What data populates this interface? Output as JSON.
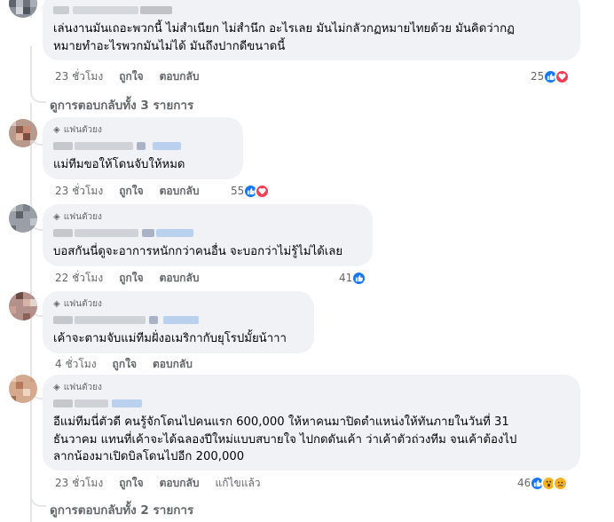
{
  "comments": [
    {
      "text": "เล่นงานมันเถอะพวกนี้ ไม่สำเนียก ไม่สำนึก อะไรเลย มันไม่กลัวกฏหมายไทยด้วย มันคิดว่ากฏ\nหมายทำอะไรพวกมันไม่ได้ มันถึงปากดีขนาดนี้",
      "time": "23 ชั่วโมง",
      "like": "ถูกใจ",
      "reply": "ตอบกลับ",
      "reactions_count": "25",
      "reactions": [
        "like-icon",
        "love-icon"
      ]
    },
    {
      "badge": "แฟนตัวยง",
      "text": "แม่ทีมขอให้โดนจับให้หมด",
      "time": "23 ชั่วโมง",
      "like": "ถูกใจ",
      "reply": "ตอบกลับ",
      "reactions_count": "55",
      "reactions": [
        "like-icon",
        "love-icon"
      ]
    },
    {
      "badge": "แฟนตัวยง",
      "text": "บอสกันนี่ดูจะอาการหนักกว่าคนอื่น จะบอกว่าไม่รู้ไม่ได้เลย",
      "time": "22 ชั่วโมง",
      "like": "ถูกใจ",
      "reply": "ตอบกลับ",
      "reactions_count": "41",
      "reactions": [
        "like-icon"
      ]
    },
    {
      "badge": "แฟนตัวยง",
      "text": "เค้าจะตามจับแม่ทีมฝั่งอเมริกากับยุโรปมั้ยน้าาา",
      "time": "4 ชั่วโมง",
      "like": "ถูกใจ",
      "reply": "ตอบกลับ",
      "reactions_count": "",
      "reactions": []
    },
    {
      "badge": "แฟนตัวยง",
      "text": "อีแม่ทีมนี่ตัวดี คนรู้จักโดนไปคนแรก 600,000 ให้หาคนมาปิดตำแหน่งให้ทันภายในวันที่ 31\nธันวาคม แทนที่เค้าจะได้ฉลองปีใหม่แบบสบายใจ ไปกดดันเค้า ว่าเค้าตัวถ่วงทีม จนเค้าต้องไป\nลากน้องมาเปิดบิลโดนไปอีก 200,000",
      "time": "23 ชั่วโมง",
      "like": "ถูกใจ",
      "reply": "ตอบกลับ",
      "edited": "แก้ไขแล้ว",
      "reactions_count": "46",
      "reactions": [
        "like-icon",
        "wow-icon",
        "sad-icon"
      ]
    }
  ],
  "more_replies": [
    "ดูการตอบกลับทั้ง 3 รายการ",
    "ดูการตอบกลับทั้ง 2 รายการ"
  ],
  "colors": {
    "bubble": "#f0f2f5",
    "secondary_text": "#65676b",
    "like": "#1877f2",
    "love": "#f33e58",
    "wow": "#f7b125"
  }
}
